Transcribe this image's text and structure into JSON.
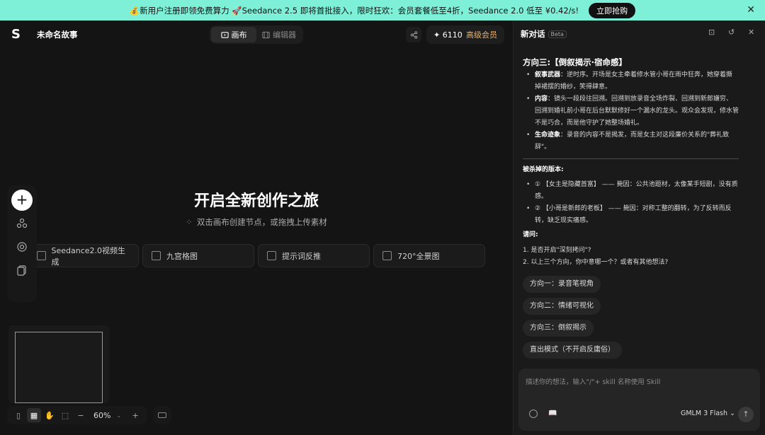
{
  "banner": {
    "text": "💰新用户注册即领免费算力 🚀Seedance 2.5 即将首批接入，限时狂欢：会员套餐低至4折，Seedance 2.0 低至 ¥0.42/s!",
    "cta": "立即抢购",
    "close": "✕",
    "bg_color": "#7ff0d8"
  },
  "topbar": {
    "logo": "S",
    "project_title": "未命名故事",
    "modes": [
      "画布",
      "编辑器"
    ],
    "active_mode": "画布",
    "credits": "✦ 6110",
    "vip": "高级会员"
  },
  "canvas": {
    "title": "开启全新创作之旅",
    "subtitle": "双击画布创建节点，或拖拽上传素材",
    "quick_actions": [
      "Seedance2.0视频生成",
      "九宫格图",
      "提示词反推",
      "720°全景图"
    ],
    "zoom": "60%"
  },
  "panel": {
    "title": "新对话",
    "beta": "Beta",
    "heading": "方向三:【倒叙揭示·宿命感】",
    "bullets": [
      {
        "label": "叙事武器",
        "text": "：逆时序。开场是女主牵着修水管小哥在雨中狂奔，她穿着撕掉裙摆的婚纱，笑得肆意。"
      },
      {
        "label": "内容",
        "text": "：镜头一段段往回溯。回溯到放录音全场炸裂、回溯到新郎嫌穷、回溯到婚礼前小哥在后台默默修好一个漏水的龙头。观众会发现，修水管不是巧合，而是他守护了她整场婚礼。"
      },
      {
        "label": "生命迹象",
        "text": "：录音的内容不是揭发，而是女主对这段廉价关系的\"葬礼致辞\"。"
      }
    ],
    "killed_title": "被杀掉的版本:",
    "killed": [
      {
        "text": "① 【女主是隐藏首富】 —— 毙因：公共池题材，太像某手短剧，没有质感。"
      },
      {
        "text": "② 【小哥是新郎的老板】 —— 毙因：对称工整的翻转，为了反转而反转，缺乏现实痛感。"
      }
    ],
    "ask_title": "请问:",
    "questions": [
      "1. 是否开启\"深刻拷问\"?",
      "2. 以上三个方向，你中意哪一个？或者有其他想法?"
    ],
    "chips": [
      "方向一：录音笔视角",
      "方向二：情绪可视化",
      "方向三：倒叙揭示",
      "直出模式（不开启反庸俗）"
    ],
    "input_placeholder": "描述你的想法，输入\"/\"+ skill 名称使用 Skill",
    "model": "GMLM 3 Flash ⌄"
  }
}
